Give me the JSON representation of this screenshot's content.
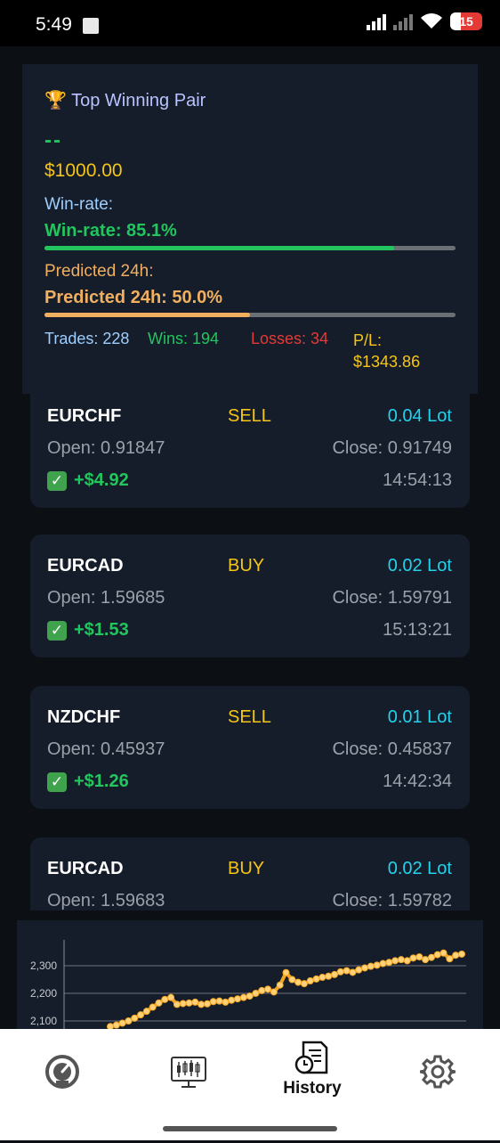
{
  "status_bar": {
    "time": "5:49",
    "battery": "15"
  },
  "top_card": {
    "trophy": "🏆",
    "title": "Top Winning Pair",
    "pair": "--",
    "amount": "$1000.00",
    "winrate_label": "Win-rate:",
    "winrate_value": "Win-rate: 85.1%",
    "winrate_fraction": 0.851,
    "predicted_label": "Predicted 24h:",
    "predicted_value": "Predicted 24h: 50.0%",
    "predicted_fraction": 0.5,
    "trades": "Trades: 228",
    "wins": "Wins: 194",
    "losses": "Losses: 34",
    "pl": "P/L: $1343.86"
  },
  "trades": [
    {
      "symbol": "EURCHF",
      "side": "SELL",
      "lot": "0.04 Lot",
      "open": "Open: 0.91847",
      "close": "Close: 0.91749",
      "pl": "+$4.92",
      "time": "14:54:13"
    },
    {
      "symbol": "EURCAD",
      "side": "BUY",
      "lot": "0.02 Lot",
      "open": "Open: 1.59685",
      "close": "Close: 1.59791",
      "pl": "+$1.53",
      "time": "15:13:21"
    },
    {
      "symbol": "NZDCHF",
      "side": "SELL",
      "lot": "0.01 Lot",
      "open": "Open: 0.45937",
      "close": "Close: 0.45837",
      "pl": "+$1.26",
      "time": "14:42:34"
    },
    {
      "symbol": "EURCAD",
      "side": "BUY",
      "lot": "0.02 Lot",
      "open": "Open: 1.59683",
      "close": "Close: 1.59782",
      "pl": "",
      "time": ""
    }
  ],
  "chart_data": {
    "type": "line",
    "title": "",
    "xlabel": "",
    "ylabel": "",
    "y_ticks": [
      "2,100",
      "2,200",
      "2,300"
    ],
    "ylim": [
      2050,
      2360
    ],
    "grid": true,
    "series": [
      {
        "color": "#f5a623",
        "values": [
          2080,
          2085,
          2092,
          2100,
          2110,
          2122,
          2135,
          2150,
          2165,
          2178,
          2185,
          2160,
          2163,
          2165,
          2168,
          2160,
          2162,
          2170,
          2172,
          2168,
          2175,
          2180,
          2185,
          2190,
          2200,
          2210,
          2215,
          2205,
          2230,
          2275,
          2250,
          2240,
          2235,
          2245,
          2252,
          2258,
          2262,
          2268,
          2278,
          2282,
          2276,
          2285,
          2292,
          2298,
          2302,
          2308,
          2312,
          2318,
          2322,
          2318,
          2328,
          2332,
          2322,
          2330,
          2340,
          2346,
          2325,
          2338,
          2342
        ]
      }
    ]
  },
  "bottom_nav": {
    "history_label": "History"
  }
}
